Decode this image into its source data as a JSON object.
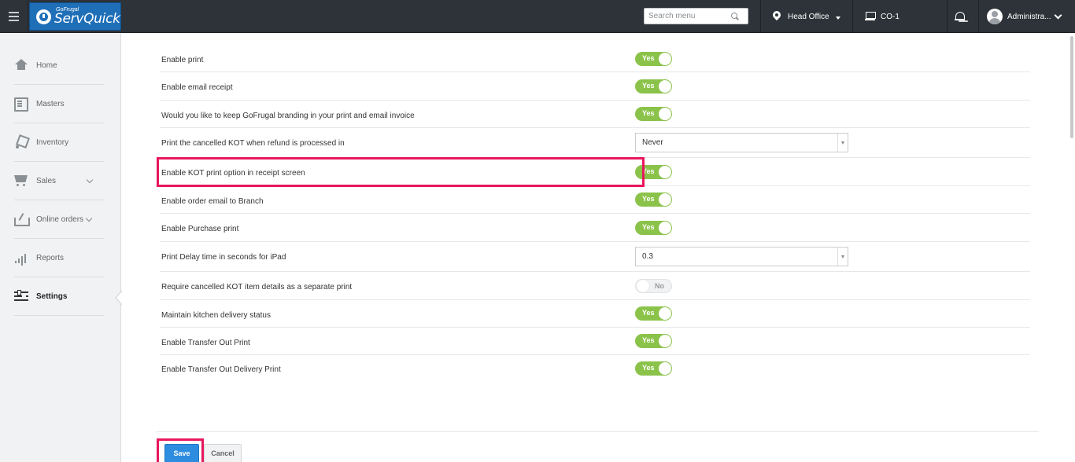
{
  "app": {
    "brand_small": "GoFrugal",
    "brand_main": "ServQuick"
  },
  "header": {
    "search_placeholder": "Search menu",
    "location": "Head Office",
    "company": "CO-1",
    "user": "Administra..."
  },
  "sidebar": {
    "items": [
      {
        "label": "Home",
        "icon": "home-icon"
      },
      {
        "label": "Masters",
        "icon": "masters-icon"
      },
      {
        "label": "Inventory",
        "icon": "inventory-icon"
      },
      {
        "label": "Sales",
        "icon": "cart-icon"
      },
      {
        "label": "Online orders",
        "icon": "online-orders-icon"
      },
      {
        "label": "Reports",
        "icon": "reports-icon"
      },
      {
        "label": "Settings",
        "icon": "settings-icon",
        "active": true
      }
    ]
  },
  "settings": [
    {
      "label": "Enable print",
      "type": "toggle",
      "value": "Yes"
    },
    {
      "label": "Enable email receipt",
      "type": "toggle",
      "value": "Yes"
    },
    {
      "label": "Would you like to keep GoFrugal branding in your print and email invoice",
      "type": "toggle",
      "value": "Yes"
    },
    {
      "label": "Print the cancelled KOT when refund is processed in",
      "type": "select",
      "value": "Never"
    },
    {
      "label": "Enable KOT print option in receipt screen",
      "type": "toggle",
      "value": "Yes",
      "highlighted": true
    },
    {
      "label": "Enable order email to Branch",
      "type": "toggle",
      "value": "Yes"
    },
    {
      "label": "Enable Purchase print",
      "type": "toggle",
      "value": "Yes"
    },
    {
      "label": "Print Delay time in seconds for iPad",
      "type": "select",
      "value": "0.3"
    },
    {
      "label": "Require cancelled KOT item details as a separate print",
      "type": "toggle",
      "value": "No"
    },
    {
      "label": "Maintain kitchen delivery status",
      "type": "toggle",
      "value": "Yes"
    },
    {
      "label": "Enable Transfer Out Print",
      "type": "toggle",
      "value": "Yes"
    },
    {
      "label": "Enable Transfer Out Delivery Print",
      "type": "toggle",
      "value": "Yes"
    }
  ],
  "footer": {
    "save_label": "Save",
    "cancel_label": "Cancel"
  },
  "colors": {
    "toggle_on": "#8bc34a",
    "highlight": "#e8175d",
    "save_button": "#2e8ddf",
    "topbar": "#2d3338"
  }
}
